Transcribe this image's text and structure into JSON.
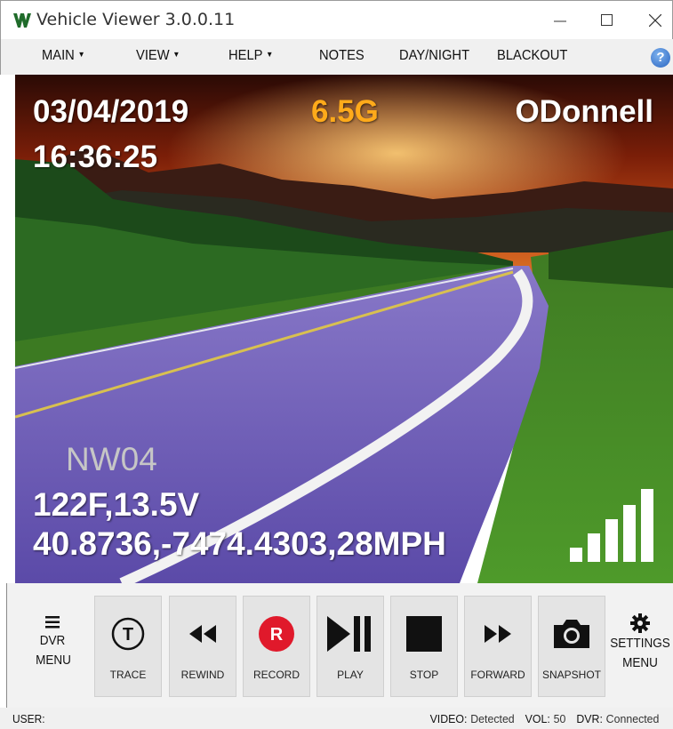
{
  "window": {
    "title": "Vehicle Viewer 3.0.0.11",
    "controls": [
      "minimize",
      "maximize",
      "close"
    ]
  },
  "menu": {
    "items": [
      {
        "label": "MAIN",
        "has_dropdown": true
      },
      {
        "label": "VIEW",
        "has_dropdown": true
      },
      {
        "label": "HELP",
        "has_dropdown": true
      },
      {
        "label": "NOTES",
        "has_dropdown": false
      },
      {
        "label": "DAY/NIGHT",
        "has_dropdown": false
      },
      {
        "label": "BLACKOUT",
        "has_dropdown": false
      }
    ],
    "help_icon": "help-circle-icon",
    "help_glyph": "?"
  },
  "overlay": {
    "date": "03/04/2019",
    "time": "16:36:25",
    "gforce": "6.5G",
    "driver": "ODonnell",
    "camera": "NW04",
    "temp_voltage": "122F,13.5V",
    "gps_speed": "40.8736,-7474.4303,28MPH",
    "signal_level": 1.0,
    "gforce_color": "#ffaa1a"
  },
  "toolbar": {
    "dvr_menu": [
      "DVR",
      "MENU"
    ],
    "settings_menu": [
      "SETTINGS",
      "MENU"
    ],
    "record_glyph": "R",
    "buttons": [
      {
        "label": "TRACE",
        "icon": "trace-icon",
        "glyph": "T"
      },
      {
        "label": "REWIND",
        "icon": "rewind-icon"
      },
      {
        "label": "RECORD",
        "icon": "record-icon"
      },
      {
        "label": "PLAY",
        "icon": "play-pause-icon"
      },
      {
        "label": "STOP",
        "icon": "stop-icon"
      },
      {
        "label": "FORWARD",
        "icon": "fast-forward-icon"
      },
      {
        "label": "SNAPSHOT",
        "icon": "camera-icon"
      }
    ],
    "record_color": "#e0192b"
  },
  "status": {
    "user_label": "USER:",
    "user_value": "",
    "video_label": "VIDEO:",
    "video_value": "Detected",
    "vol_label": "VOL:",
    "vol_value": "50",
    "dvr_label": "DVR:",
    "dvr_value": "Connected"
  }
}
